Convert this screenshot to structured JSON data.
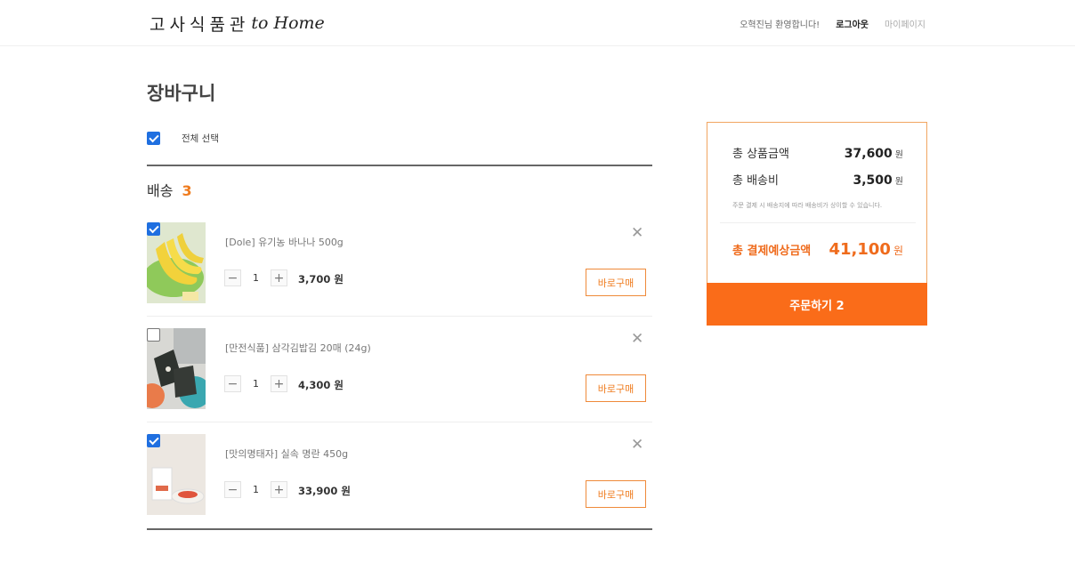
{
  "header": {
    "logo_ko": "고사식품관",
    "logo_en": "to Home",
    "welcome": "오혁진님 환영합니다!",
    "logout": "로그아웃",
    "mypage": "마이페이지"
  },
  "page_title": "장바구니",
  "select_all": {
    "label": "전체 선택",
    "checked": true
  },
  "section": {
    "title": "배송",
    "count": "3"
  },
  "items": [
    {
      "name": "[Dole] 유기농 바나나 500g",
      "qty": "1",
      "price": "3,700 원",
      "buy_label": "바로구매",
      "checked": true,
      "remove_glyph": "✕",
      "image": "banana-image"
    },
    {
      "name": "[만전식품] 삼각김밥김 20매 (24g)",
      "qty": "1",
      "price": "4,300 원",
      "buy_label": "바로구매",
      "checked": false,
      "remove_glyph": "✕",
      "image": "seaweed-image"
    },
    {
      "name": "[맛의명태자] 실속 명란 450g",
      "qty": "1",
      "price": "33,900 원",
      "buy_label": "바로구매",
      "checked": true,
      "remove_glyph": "✕",
      "image": "pollock-roe-image"
    }
  ],
  "qty_controls": {
    "minus": "−",
    "plus": "+"
  },
  "summary": {
    "product_label": "총 상품금액",
    "product_value": "37,600",
    "shipping_label": "총 배송비",
    "shipping_value": "3,500",
    "unit": "원",
    "note": "주문 결제 시 배송지에 따라 배송비가 상이할 수 있습니다.",
    "total_label": "총 결제예상금액",
    "total_value": "41,100",
    "order_button": "주문하기 2"
  },
  "colors": {
    "accent": "#fa6c19",
    "accent_text": "#ef7c1f",
    "checkbox": "#1f6fe0",
    "border_accent": "#f1a561"
  }
}
